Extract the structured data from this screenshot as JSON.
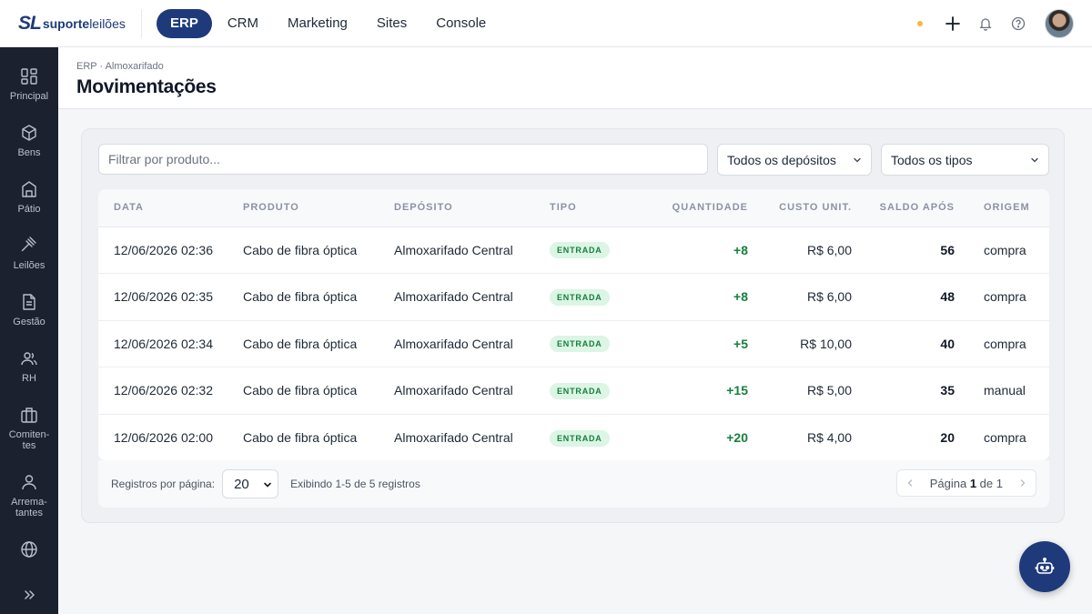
{
  "brand": {
    "mark": "SL",
    "name_bold": "suporte",
    "name_rest": "leilões"
  },
  "nav": {
    "items": [
      "ERP",
      "CRM",
      "Marketing",
      "Sites",
      "Console"
    ],
    "active": "ERP"
  },
  "sidebar": {
    "items": [
      {
        "label": "Principal",
        "icon": "grid-icon"
      },
      {
        "label": "Bens",
        "icon": "box-icon"
      },
      {
        "label": "Pátio",
        "icon": "building-icon"
      },
      {
        "label": "Leilões",
        "icon": "gavel-icon"
      },
      {
        "label": "Gestão",
        "icon": "document-icon"
      },
      {
        "label": "RH",
        "icon": "users-icon"
      },
      {
        "label": "Comiten-\ntes",
        "icon": "briefcase-icon"
      },
      {
        "label": "Arrema-\ntantes",
        "icon": "user-icon"
      },
      {
        "label": "",
        "icon": "globe-icon"
      }
    ]
  },
  "header": {
    "breadcrumb": "ERP · Almoxarifado",
    "title": "Movimentações"
  },
  "filters": {
    "search_placeholder": "Filtrar por produto...",
    "deposit": "Todos os depósitos",
    "type": "Todos os tipos"
  },
  "table": {
    "columns": [
      "Data",
      "Produto",
      "Depósito",
      "Tipo",
      "Quantidade",
      "Custo unit.",
      "Saldo após",
      "Origem"
    ],
    "rows": [
      {
        "date": "12/06/2026 02:36",
        "product": "Cabo de fibra óptica",
        "deposit": "Almoxarifado Central",
        "type": "ENTRADA",
        "qty": "+8",
        "cost": "R$ 6,00",
        "balance": "56",
        "origin": "compra"
      },
      {
        "date": "12/06/2026 02:35",
        "product": "Cabo de fibra óptica",
        "deposit": "Almoxarifado Central",
        "type": "ENTRADA",
        "qty": "+8",
        "cost": "R$ 6,00",
        "balance": "48",
        "origin": "compra"
      },
      {
        "date": "12/06/2026 02:34",
        "product": "Cabo de fibra óptica",
        "deposit": "Almoxarifado Central",
        "type": "ENTRADA",
        "qty": "+5",
        "cost": "R$ 10,00",
        "balance": "40",
        "origin": "compra"
      },
      {
        "date": "12/06/2026 02:32",
        "product": "Cabo de fibra óptica",
        "deposit": "Almoxarifado Central",
        "type": "ENTRADA",
        "qty": "+15",
        "cost": "R$ 5,00",
        "balance": "35",
        "origin": "manual"
      },
      {
        "date": "12/06/2026 02:00",
        "product": "Cabo de fibra óptica",
        "deposit": "Almoxarifado Central",
        "type": "ENTRADA",
        "qty": "+20",
        "cost": "R$ 4,00",
        "balance": "20",
        "origin": "compra"
      }
    ]
  },
  "footer": {
    "per_page_label": "Registros por página:",
    "per_page": "20",
    "showing": "Exibindo 1-5 de 5 registros",
    "page_word": "Página",
    "page": "1",
    "of_word": "de",
    "total_pages": "1"
  },
  "colors": {
    "primary": "#1e3a7b",
    "sidebar": "#1c2130",
    "success": "#15803d",
    "badge_bg": "#dcf5e4",
    "notify_dot": "#f6b73c"
  }
}
